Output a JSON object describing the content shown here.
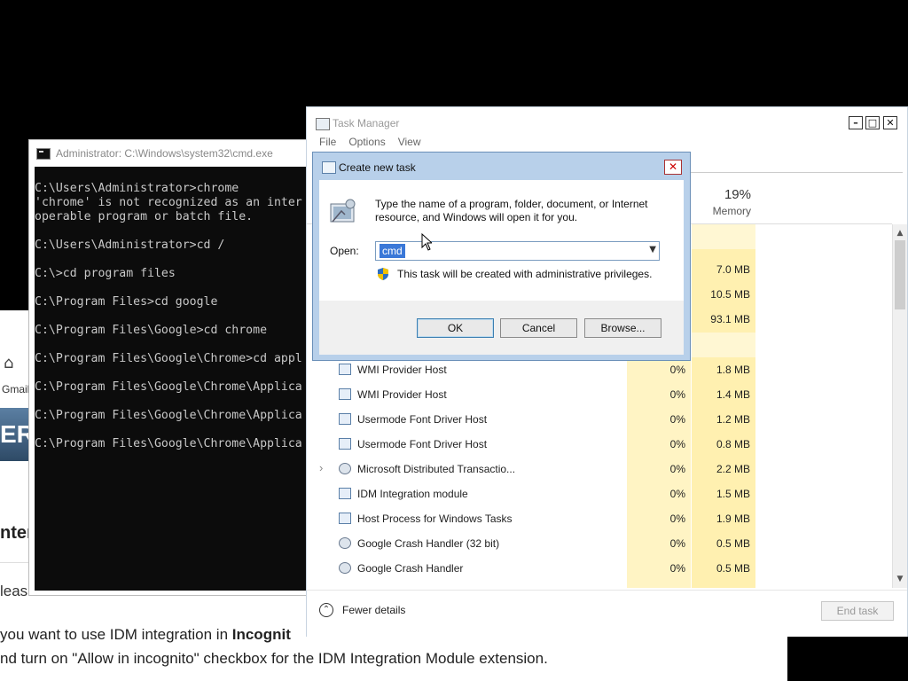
{
  "browser": {
    "gmail_label": "Gmail",
    "banner_text": "ER",
    "heading_fragment": "nter",
    "please_fragment": "leas",
    "paragraph": {
      "line1_pre": "you want to use IDM integration in ",
      "line1_bold": "Incognit",
      "line2": "nd turn on \"Allow in incognito\" checkbox for the IDM Integration Module extension."
    }
  },
  "cmd": {
    "title": "Administrator: C:\\Windows\\system32\\cmd.exe",
    "lines": [
      "C:\\Users\\Administrator>chrome",
      "'chrome' is not recognized as an inter",
      "operable program or batch file.",
      "",
      "C:\\Users\\Administrator>cd /",
      "",
      "C:\\>cd program files",
      "",
      "C:\\Program Files>cd google",
      "",
      "C:\\Program Files\\Google>cd chrome",
      "",
      "C:\\Program Files\\Google\\Chrome>cd appl",
      "",
      "C:\\Program Files\\Google\\Chrome\\Applica",
      "",
      "C:\\Program Files\\Google\\Chrome\\Applica",
      "",
      "C:\\Program Files\\Google\\Chrome\\Applica"
    ]
  },
  "task_manager": {
    "title": "Task Manager",
    "menu": [
      "File",
      "Options",
      "View"
    ],
    "window_buttons": {
      "minimize": "–",
      "maximize": "□",
      "close": "✕"
    },
    "columns": {
      "memory": {
        "percent": "19%",
        "label": "Memory"
      }
    },
    "top_rows_memory": [
      "7.0 MB",
      "10.5 MB",
      "93.1 MB"
    ],
    "processes": [
      {
        "name": "WMI Provider Host",
        "cpu": "0%",
        "memory": "1.8 MB",
        "icon": "service-icon",
        "expandable": false
      },
      {
        "name": "WMI Provider Host",
        "cpu": "0%",
        "memory": "1.4 MB",
        "icon": "service-icon",
        "expandable": false
      },
      {
        "name": "Usermode Font Driver Host",
        "cpu": "0%",
        "memory": "1.2 MB",
        "icon": "window-icon",
        "expandable": false
      },
      {
        "name": "Usermode Font Driver Host",
        "cpu": "0%",
        "memory": "0.8 MB",
        "icon": "window-icon",
        "expandable": false
      },
      {
        "name": "Microsoft Distributed Transactio...",
        "cpu": "0%",
        "memory": "2.2 MB",
        "icon": "gear-icon",
        "expandable": true
      },
      {
        "name": "IDM Integration module",
        "cpu": "0%",
        "memory": "1.5 MB",
        "icon": "window-icon",
        "expandable": false
      },
      {
        "name": "Host Process for Windows Tasks",
        "cpu": "0%",
        "memory": "1.9 MB",
        "icon": "window-icon",
        "expandable": false
      },
      {
        "name": "Google Crash Handler (32 bit)",
        "cpu": "0%",
        "memory": "0.5 MB",
        "icon": "gear-icon",
        "expandable": false
      },
      {
        "name": "Google Crash Handler",
        "cpu": "0%",
        "memory": "0.5 MB",
        "icon": "gear-icon",
        "expandable": false
      }
    ],
    "footer": {
      "fewer_details": "Fewer details",
      "end_task": "End task"
    }
  },
  "dialog": {
    "title": "Create new task",
    "description": "Type the name of a program, folder, document, or Internet resource, and Windows will open it for you.",
    "open_label": "Open:",
    "open_value": "cmd",
    "admin_note": "This task will be created with administrative privileges.",
    "buttons": {
      "ok": "OK",
      "cancel": "Cancel",
      "browse": "Browse..."
    }
  }
}
